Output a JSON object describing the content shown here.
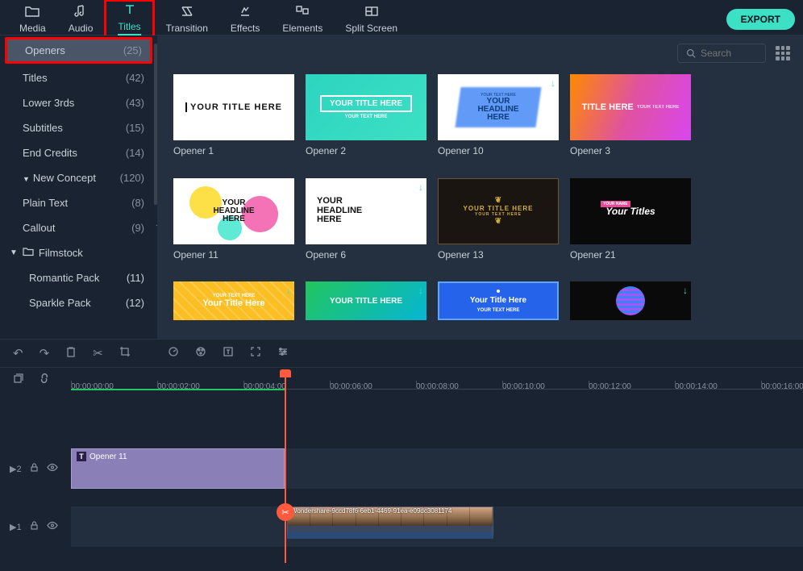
{
  "topTabs": [
    {
      "label": "Media",
      "icon": "folder"
    },
    {
      "label": "Audio",
      "icon": "audio"
    },
    {
      "label": "Titles",
      "icon": "text",
      "active": true,
      "highlighted": true
    },
    {
      "label": "Transition",
      "icon": "transition"
    },
    {
      "label": "Effects",
      "icon": "effects"
    },
    {
      "label": "Elements",
      "icon": "elements"
    },
    {
      "label": "Split Screen",
      "icon": "split"
    }
  ],
  "exportLabel": "EXPORT",
  "searchPlaceholder": "Search",
  "sidebar": {
    "items": [
      {
        "label": "Openers",
        "count": "(25)",
        "selected": true,
        "highlighted": true
      },
      {
        "label": "Titles",
        "count": "(42)"
      },
      {
        "label": "Lower 3rds",
        "count": "(43)"
      },
      {
        "label": "Subtitles",
        "count": "(15)"
      },
      {
        "label": "End Credits",
        "count": "(14)"
      },
      {
        "label": "New Concept",
        "count": "(120)",
        "hasChevron": true
      },
      {
        "label": "Plain Text",
        "count": "(8)"
      },
      {
        "label": "Callout",
        "count": "(9)"
      }
    ],
    "group": {
      "label": "Filmstock"
    },
    "groupItems": [
      {
        "label": "Romantic Pack",
        "count": "(11)"
      },
      {
        "label": "Sparkle Pack",
        "count": "(12)"
      }
    ]
  },
  "thumbs": [
    {
      "label": "Opener 1",
      "style": "t1",
      "text": "YOUR TITLE HERE"
    },
    {
      "label": "Opener 2",
      "style": "t2",
      "text": "YOUR TITLE HERE",
      "sub": "YOUR TEXT HERE"
    },
    {
      "label": "Opener 10",
      "style": "t3",
      "top": "YOUR TEXT HERE",
      "mid": "YOUR",
      "mid2": "HEADLINE",
      "bot": "HERE",
      "dl": true
    },
    {
      "label": "Opener 3",
      "style": "t4",
      "text": "TITLE HERE",
      "sub": "YOUR TEXT HERE"
    },
    {
      "label": "Opener 11",
      "style": "t5",
      "top": "YOUR",
      "mid": "HEADLINE",
      "bot": "HERE"
    },
    {
      "label": "Opener 6",
      "style": "t6",
      "top": "YOUR",
      "mid": "HEADLINE",
      "bot": "HERE",
      "dl": true
    },
    {
      "label": "Opener 13",
      "style": "t7",
      "text": "YOUR TITLE HERE",
      "sub": "YOUR TEXT HERE"
    },
    {
      "label": "Opener 21",
      "style": "t8",
      "tag": "YOUR NAME",
      "text": "Your Titles"
    },
    {
      "label": "",
      "style": "t9",
      "top": "YOUR TEXT HERE",
      "text": "Your Title Here",
      "dl": true
    },
    {
      "label": "",
      "style": "t10",
      "text": "YOUR TITLE HERE",
      "dl": true
    },
    {
      "label": "",
      "style": "t11",
      "text": "Your Title Here",
      "sub": "YOUR TEXT HERE"
    },
    {
      "label": "",
      "style": "t12",
      "dl": true
    }
  ],
  "timeline": {
    "ticks": [
      "00:00:00:00",
      "00:00:02:00",
      "00:00:04:00",
      "00:00:06:00",
      "00:00:08:00",
      "00:00:10:00",
      "00:00:12:00",
      "00:00:14:00",
      "00:00:16:00"
    ],
    "track1Label": "2",
    "track2Label": "1",
    "titleClipLabel": "Opener 11",
    "videoClipLabel": "Wondershare-9ccd78f6-6eb1-4469-91ea-e09dc3081174"
  }
}
